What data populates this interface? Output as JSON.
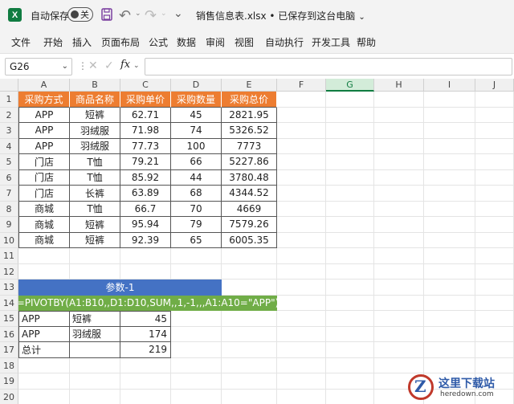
{
  "titlebar": {
    "app_logo": "X",
    "autosave_label": "自动保存",
    "toggle_state": "关",
    "filename": "销售信息表.xlsx • 已保存到这台电脑",
    "icons": [
      "excel-logo-icon",
      "save-icon",
      "undo-icon",
      "redo-icon",
      "more-icon",
      "chevron-down-icon"
    ]
  },
  "menu": {
    "items": [
      "文件",
      "开始",
      "插入",
      "页面布局",
      "公式",
      "数据",
      "审阅",
      "视图",
      "自动执行",
      "开发工具",
      "帮助"
    ]
  },
  "formula_bar": {
    "name_box": "G26",
    "separator": "⋮",
    "fx": "fx",
    "value": ""
  },
  "sheet": {
    "columns": [
      "A",
      "B",
      "C",
      "D",
      "E",
      "F",
      "G",
      "H",
      "I",
      "J"
    ],
    "active_column": "G",
    "rows": [
      "1",
      "2",
      "3",
      "4",
      "5",
      "6",
      "7",
      "8",
      "9",
      "10",
      "11",
      "12",
      "13",
      "14",
      "15",
      "16",
      "17",
      "18",
      "19",
      "20"
    ],
    "headers": [
      "采购方式",
      "商品名称",
      "采购单价",
      "采购数量",
      "采购总价"
    ],
    "data": [
      [
        "APP",
        "短裤",
        "62.71",
        "45",
        "2821.95"
      ],
      [
        "APP",
        "羽绒服",
        "71.98",
        "74",
        "5326.52"
      ],
      [
        "APP",
        "羽绒服",
        "77.73",
        "100",
        "7773"
      ],
      [
        "门店",
        "T恤",
        "79.21",
        "66",
        "5227.86"
      ],
      [
        "门店",
        "T恤",
        "85.92",
        "44",
        "3780.48"
      ],
      [
        "门店",
        "长裤",
        "63.89",
        "68",
        "4344.52"
      ],
      [
        "商城",
        "T恤",
        "66.7",
        "70",
        "4669"
      ],
      [
        "商城",
        "短裤",
        "95.94",
        "79",
        "7579.26"
      ],
      [
        "商城",
        "短裤",
        "92.39",
        "65",
        "6005.35"
      ]
    ],
    "param_label": "参数-1",
    "formula_text": "=PIVOTBY(A1:B10,,D1:D10,SUM,,1,-1,,,A1:A10=\"APP\")",
    "pivot": [
      [
        "APP",
        "短裤",
        "45"
      ],
      [
        "APP",
        "羽绒服",
        "174"
      ],
      [
        "总计",
        "",
        "219"
      ]
    ]
  },
  "watermark": {
    "letter": "Z",
    "title": "这里下载站",
    "subtitle": "heredown.com"
  },
  "colors": {
    "header_fill": "#ed7d31",
    "param_fill": "#4472c4",
    "formula_fill": "#70ad47",
    "excel_green": "#107c41"
  }
}
